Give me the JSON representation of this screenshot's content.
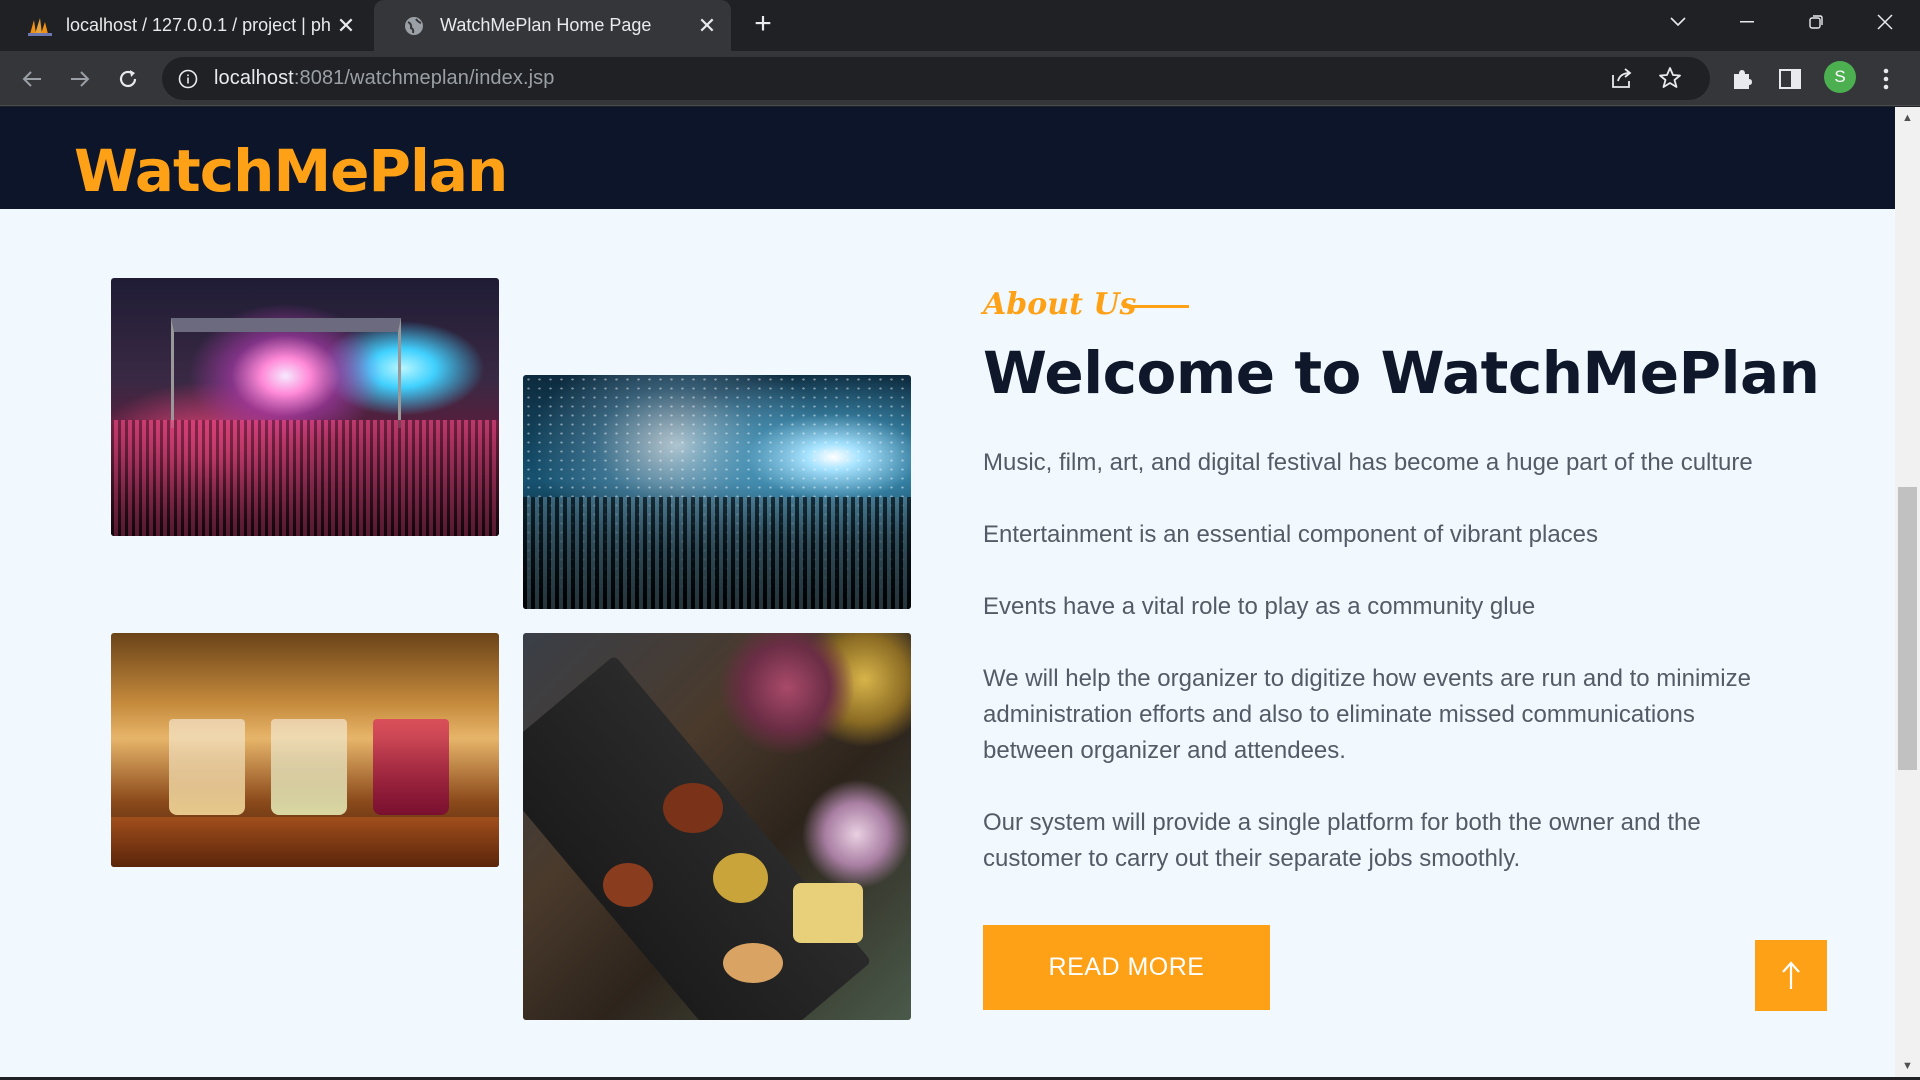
{
  "browser": {
    "tabs": [
      {
        "title": "localhost / 127.0.0.1 / project | ph",
        "active": false
      },
      {
        "title": "WatchMePlan Home Page",
        "active": true
      }
    ],
    "address": {
      "host": "localhost",
      "rest": ":8081/watchmeplan/index.jsp"
    },
    "profile_initial": "S"
  },
  "site": {
    "brand": "WatchMePlan",
    "about_label": "About Us",
    "heading": "Welcome to WatchMePlan",
    "paragraphs": [
      "Music, film, art, and digital festival has become a huge part of the culture",
      "Entertainment is an essential component of vibrant places",
      "Events have a vital role to play as a community glue",
      "We will help the organizer to digitize how events are run and to minimize administration efforts and also to eliminate missed communications between organizer and attendees.",
      "Our system will provide a single platform for both the owner and the customer to carry out their separate jobs smoothly."
    ],
    "read_more": "READ MORE"
  },
  "colors": {
    "accent": "#fea116",
    "header_bg": "#0c1529",
    "page_bg": "#f1f8fe",
    "heading": "#0f172b",
    "body_text": "#555b66"
  }
}
